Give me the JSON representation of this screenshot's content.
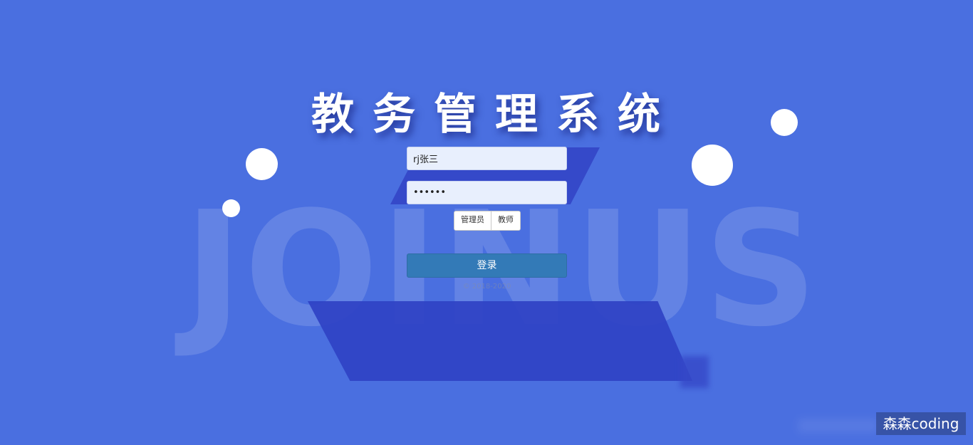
{
  "background_word": "JOINUS",
  "title": "教务管理系统",
  "login": {
    "username_value": "rj张三",
    "password_value": "••••••",
    "roles": [
      "管理员",
      "教师"
    ],
    "submit_label": "登录",
    "copyright": "© 2018-2020"
  },
  "watermark": "森森coding",
  "colors": {
    "background": "#4a6fe0",
    "shape": "#2f42c4",
    "button": "#337ab7",
    "input": "#e8effd"
  }
}
